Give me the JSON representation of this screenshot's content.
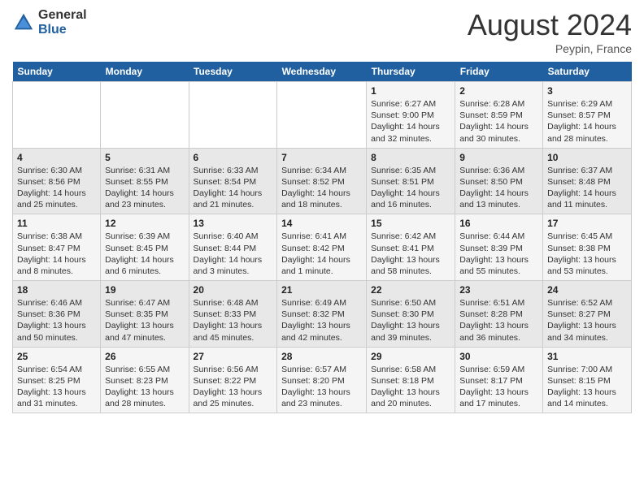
{
  "header": {
    "logo_general": "General",
    "logo_blue": "Blue",
    "month_title": "August 2024",
    "location": "Peypin, France"
  },
  "weekdays": [
    "Sunday",
    "Monday",
    "Tuesday",
    "Wednesday",
    "Thursday",
    "Friday",
    "Saturday"
  ],
  "weeks": [
    [
      {
        "day": "",
        "sunrise": "",
        "sunset": "",
        "daylight": ""
      },
      {
        "day": "",
        "sunrise": "",
        "sunset": "",
        "daylight": ""
      },
      {
        "day": "",
        "sunrise": "",
        "sunset": "",
        "daylight": ""
      },
      {
        "day": "",
        "sunrise": "",
        "sunset": "",
        "daylight": ""
      },
      {
        "day": "1",
        "sunrise": "Sunrise: 6:27 AM",
        "sunset": "Sunset: 9:00 PM",
        "daylight": "Daylight: 14 hours and 32 minutes."
      },
      {
        "day": "2",
        "sunrise": "Sunrise: 6:28 AM",
        "sunset": "Sunset: 8:59 PM",
        "daylight": "Daylight: 14 hours and 30 minutes."
      },
      {
        "day": "3",
        "sunrise": "Sunrise: 6:29 AM",
        "sunset": "Sunset: 8:57 PM",
        "daylight": "Daylight: 14 hours and 28 minutes."
      }
    ],
    [
      {
        "day": "4",
        "sunrise": "Sunrise: 6:30 AM",
        "sunset": "Sunset: 8:56 PM",
        "daylight": "Daylight: 14 hours and 25 minutes."
      },
      {
        "day": "5",
        "sunrise": "Sunrise: 6:31 AM",
        "sunset": "Sunset: 8:55 PM",
        "daylight": "Daylight: 14 hours and 23 minutes."
      },
      {
        "day": "6",
        "sunrise": "Sunrise: 6:33 AM",
        "sunset": "Sunset: 8:54 PM",
        "daylight": "Daylight: 14 hours and 21 minutes."
      },
      {
        "day": "7",
        "sunrise": "Sunrise: 6:34 AM",
        "sunset": "Sunset: 8:52 PM",
        "daylight": "Daylight: 14 hours and 18 minutes."
      },
      {
        "day": "8",
        "sunrise": "Sunrise: 6:35 AM",
        "sunset": "Sunset: 8:51 PM",
        "daylight": "Daylight: 14 hours and 16 minutes."
      },
      {
        "day": "9",
        "sunrise": "Sunrise: 6:36 AM",
        "sunset": "Sunset: 8:50 PM",
        "daylight": "Daylight: 14 hours and 13 minutes."
      },
      {
        "day": "10",
        "sunrise": "Sunrise: 6:37 AM",
        "sunset": "Sunset: 8:48 PM",
        "daylight": "Daylight: 14 hours and 11 minutes."
      }
    ],
    [
      {
        "day": "11",
        "sunrise": "Sunrise: 6:38 AM",
        "sunset": "Sunset: 8:47 PM",
        "daylight": "Daylight: 14 hours and 8 minutes."
      },
      {
        "day": "12",
        "sunrise": "Sunrise: 6:39 AM",
        "sunset": "Sunset: 8:45 PM",
        "daylight": "Daylight: 14 hours and 6 minutes."
      },
      {
        "day": "13",
        "sunrise": "Sunrise: 6:40 AM",
        "sunset": "Sunset: 8:44 PM",
        "daylight": "Daylight: 14 hours and 3 minutes."
      },
      {
        "day": "14",
        "sunrise": "Sunrise: 6:41 AM",
        "sunset": "Sunset: 8:42 PM",
        "daylight": "Daylight: 14 hours and 1 minute."
      },
      {
        "day": "15",
        "sunrise": "Sunrise: 6:42 AM",
        "sunset": "Sunset: 8:41 PM",
        "daylight": "Daylight: 13 hours and 58 minutes."
      },
      {
        "day": "16",
        "sunrise": "Sunrise: 6:44 AM",
        "sunset": "Sunset: 8:39 PM",
        "daylight": "Daylight: 13 hours and 55 minutes."
      },
      {
        "day": "17",
        "sunrise": "Sunrise: 6:45 AM",
        "sunset": "Sunset: 8:38 PM",
        "daylight": "Daylight: 13 hours and 53 minutes."
      }
    ],
    [
      {
        "day": "18",
        "sunrise": "Sunrise: 6:46 AM",
        "sunset": "Sunset: 8:36 PM",
        "daylight": "Daylight: 13 hours and 50 minutes."
      },
      {
        "day": "19",
        "sunrise": "Sunrise: 6:47 AM",
        "sunset": "Sunset: 8:35 PM",
        "daylight": "Daylight: 13 hours and 47 minutes."
      },
      {
        "day": "20",
        "sunrise": "Sunrise: 6:48 AM",
        "sunset": "Sunset: 8:33 PM",
        "daylight": "Daylight: 13 hours and 45 minutes."
      },
      {
        "day": "21",
        "sunrise": "Sunrise: 6:49 AM",
        "sunset": "Sunset: 8:32 PM",
        "daylight": "Daylight: 13 hours and 42 minutes."
      },
      {
        "day": "22",
        "sunrise": "Sunrise: 6:50 AM",
        "sunset": "Sunset: 8:30 PM",
        "daylight": "Daylight: 13 hours and 39 minutes."
      },
      {
        "day": "23",
        "sunrise": "Sunrise: 6:51 AM",
        "sunset": "Sunset: 8:28 PM",
        "daylight": "Daylight: 13 hours and 36 minutes."
      },
      {
        "day": "24",
        "sunrise": "Sunrise: 6:52 AM",
        "sunset": "Sunset: 8:27 PM",
        "daylight": "Daylight: 13 hours and 34 minutes."
      }
    ],
    [
      {
        "day": "25",
        "sunrise": "Sunrise: 6:54 AM",
        "sunset": "Sunset: 8:25 PM",
        "daylight": "Daylight: 13 hours and 31 minutes."
      },
      {
        "day": "26",
        "sunrise": "Sunrise: 6:55 AM",
        "sunset": "Sunset: 8:23 PM",
        "daylight": "Daylight: 13 hours and 28 minutes."
      },
      {
        "day": "27",
        "sunrise": "Sunrise: 6:56 AM",
        "sunset": "Sunset: 8:22 PM",
        "daylight": "Daylight: 13 hours and 25 minutes."
      },
      {
        "day": "28",
        "sunrise": "Sunrise: 6:57 AM",
        "sunset": "Sunset: 8:20 PM",
        "daylight": "Daylight: 13 hours and 23 minutes."
      },
      {
        "day": "29",
        "sunrise": "Sunrise: 6:58 AM",
        "sunset": "Sunset: 8:18 PM",
        "daylight": "Daylight: 13 hours and 20 minutes."
      },
      {
        "day": "30",
        "sunrise": "Sunrise: 6:59 AM",
        "sunset": "Sunset: 8:17 PM",
        "daylight": "Daylight: 13 hours and 17 minutes."
      },
      {
        "day": "31",
        "sunrise": "Sunrise: 7:00 AM",
        "sunset": "Sunset: 8:15 PM",
        "daylight": "Daylight: 13 hours and 14 minutes."
      }
    ]
  ]
}
